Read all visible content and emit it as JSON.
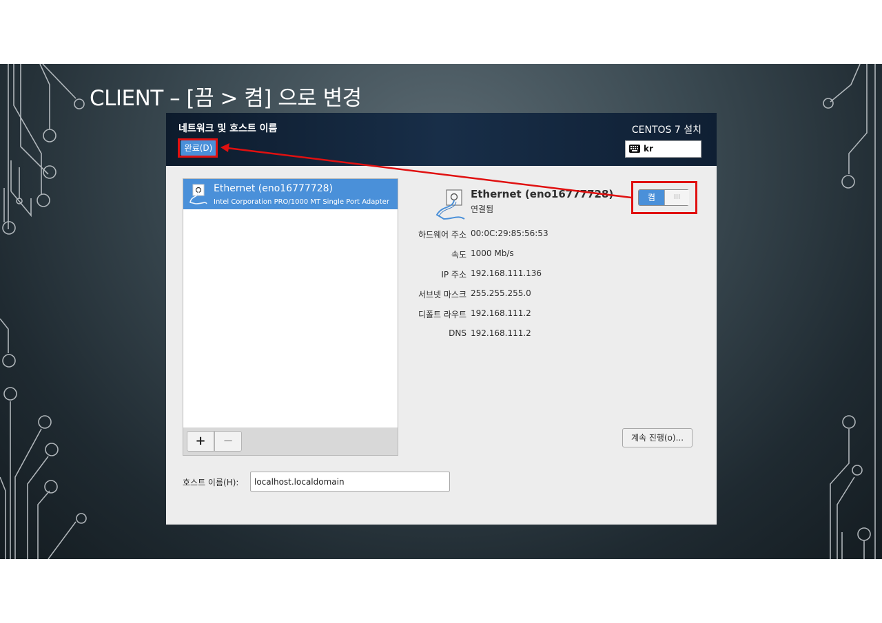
{
  "slide": {
    "title": "CLIENT – [끔 > 켬] 으로 변경"
  },
  "window": {
    "title": "네트워크 및 호스트 이름",
    "done_button": "완료(D)",
    "installer_title": "CENTOS 7 설치",
    "keyboard_layout": "kr"
  },
  "devices": [
    {
      "name": "Ethernet (eno16777728)",
      "description": "Intel Corporation PRO/1000 MT Single Port Adapter",
      "selected": true
    }
  ],
  "list_toolbar": {
    "add_label": "+",
    "remove_label": "−"
  },
  "detail": {
    "title": "Ethernet (eno16777728)",
    "status": "연결됨",
    "toggle_label": "켬",
    "toggle_off_glyph": "III",
    "properties": [
      {
        "label": "하드웨어 주소",
        "value": "00:0C:29:85:56:53"
      },
      {
        "label": "속도",
        "value": "1000 Mb/s"
      },
      {
        "label": "IP 주소",
        "value": "192.168.111.136"
      },
      {
        "label": "서브넷 마스크",
        "value": "255.255.255.0"
      },
      {
        "label": "디폴트 라우트",
        "value": "192.168.111.2"
      },
      {
        "label": "DNS",
        "value": "192.168.111.2"
      }
    ],
    "configure_button": "계속 진행(o)..."
  },
  "hostname": {
    "label": "호스트 이름(H):",
    "value": "localhost.localdomain"
  },
  "colors": {
    "accent": "#4a90d9",
    "highlight": "#e01010",
    "header": "#132540"
  }
}
